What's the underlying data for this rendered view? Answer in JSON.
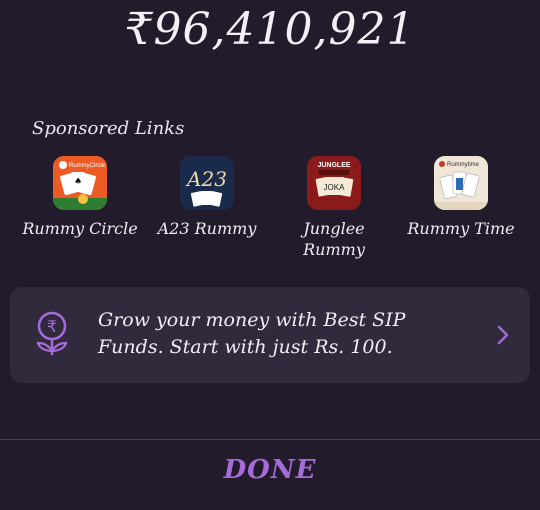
{
  "balance": {
    "amount": "₹96,410,921"
  },
  "sponsored": {
    "title": "Sponsored Links",
    "apps": [
      {
        "label": "Rummy Circle",
        "icon": "rummycircle-app-icon",
        "icon_text": "RummyCircle",
        "color": "#ee5a24"
      },
      {
        "label": "A23 Rummy",
        "icon": "a23-app-icon",
        "icon_text": "A23",
        "color": "#1a2a4a"
      },
      {
        "label": "Junglee Rummy",
        "icon": "junglee-app-icon",
        "icon_text": "JUNGLEE",
        "color": "#8b1a1a"
      },
      {
        "label": "Rummy Time",
        "icon": "rummytime-app-icon",
        "icon_text": "Rummytime",
        "color": "#f0e6d8"
      }
    ]
  },
  "sip": {
    "text": "Grow your money with Best SIP Funds. Start with just Rs. 100.",
    "icon": "rupee-plant-icon",
    "accent": "#a56bd8"
  },
  "footer": {
    "done_label": "DONE"
  }
}
